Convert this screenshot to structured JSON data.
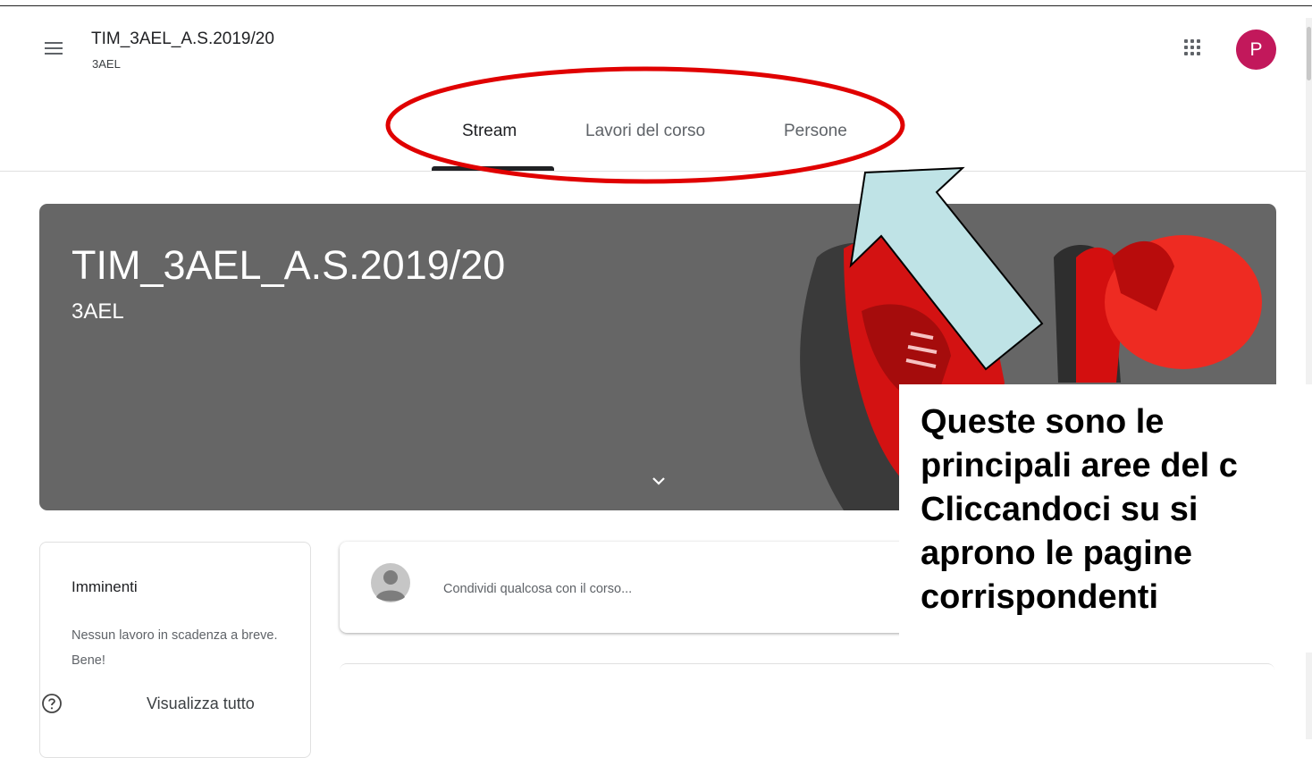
{
  "header": {
    "class_title": "TIM_3AEL_A.S.2019/20",
    "class_section": "3AEL",
    "avatar_initial": "P",
    "avatar_color": "#c2185b"
  },
  "tabs": [
    {
      "label": "Stream",
      "active": true
    },
    {
      "label": "Lavori del corso",
      "active": false
    },
    {
      "label": "Persone",
      "active": false
    }
  ],
  "banner": {
    "title": "TIM_3AEL_A.S.2019/20",
    "section": "3AEL",
    "background_color": "#666666"
  },
  "upcoming": {
    "title": "Imminenti",
    "message": "Nessun lavoro in scadenza a breve. Bene!",
    "view_all": "Visualizza tutto"
  },
  "share": {
    "placeholder": "Condividi qualcosa con il corso..."
  },
  "annotation": {
    "lines": [
      "Queste sono le",
      "principali aree del c",
      "Cliccandoci su si",
      "aprono le pagine",
      "corrispondenti"
    ],
    "ellipse_color": "#e00000",
    "arrow_color": "#bfe3e6"
  }
}
